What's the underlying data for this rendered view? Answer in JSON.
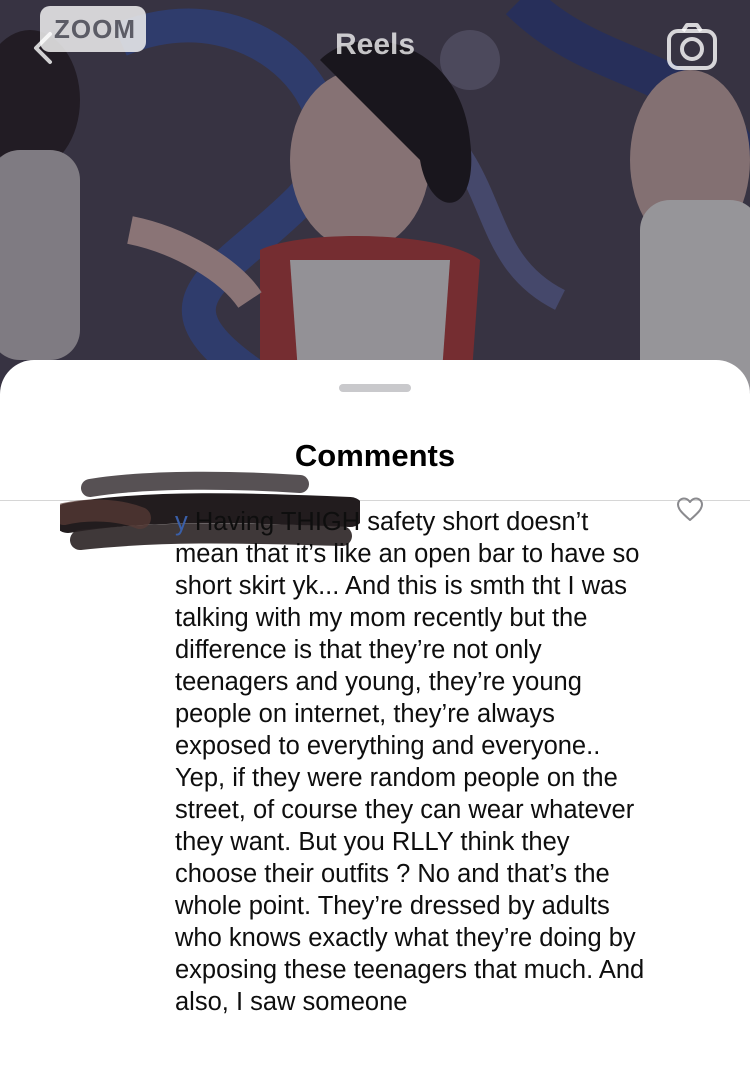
{
  "header": {
    "title": "Reels",
    "watermark": "ZOOM",
    "back_icon": "chevron-left-icon",
    "camera_icon": "camera-icon"
  },
  "sheet": {
    "title": "Comments"
  },
  "comment": {
    "username": "y",
    "text": "Having THIGH safety short doesn’t mean that it’s like an open bar to have so short skirt yk... And this is smth tht I was talking with my mom recently but the difference is that they’re not only teenagers and young, they’re young people on internet, they’re always exposed to everything and everyone.. Yep, if they were random people on the street, of course they can wear whatever they want. But you RLLY think they choose their outfits ? No and that’s the whole point. They’re dressed by adults who knows exactly what they’re doing by exposing these teenagers that much. And also, I saw someone",
    "like_icon": "heart-outline-icon"
  },
  "colors": {
    "username": "#3a5fa8",
    "sheet_bg": "#ffffff",
    "grabber": "#c9c9cc",
    "divider": "#d6d6d6"
  }
}
